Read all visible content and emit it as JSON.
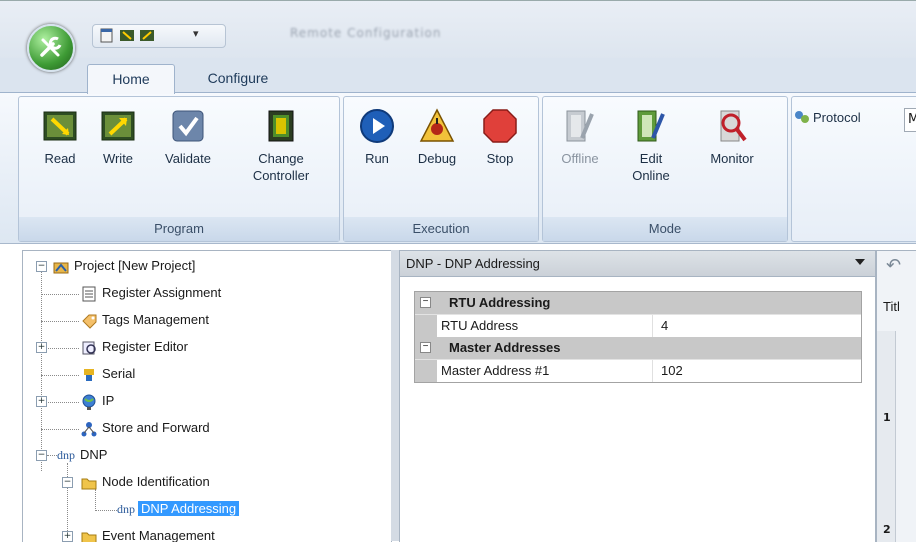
{
  "window": {
    "title_blurred": "Remote Configuration"
  },
  "tabs": [
    {
      "label": "Home",
      "active": true
    },
    {
      "label": "Configure",
      "active": false
    }
  ],
  "ribbon": {
    "groups": [
      {
        "title": "Program",
        "buttons": [
          {
            "label": "Read"
          },
          {
            "label": "Write"
          },
          {
            "label": "Validate"
          },
          {
            "label_line1": "Change",
            "label_line2": "Controller"
          }
        ]
      },
      {
        "title": "Execution",
        "buttons": [
          {
            "label": "Run"
          },
          {
            "label": "Debug"
          },
          {
            "label": "Stop"
          }
        ]
      },
      {
        "title": "Mode",
        "buttons": [
          {
            "label": "Offline",
            "enabled": false
          },
          {
            "label_line1": "Edit",
            "label_line2": "Online"
          },
          {
            "label": "Monitor"
          }
        ]
      }
    ],
    "protocol_label": "Protocol",
    "protocol_value": "M"
  },
  "tree": {
    "items": [
      {
        "label": "Project [New Project]"
      },
      {
        "label": "Register Assignment"
      },
      {
        "label": "Tags Management"
      },
      {
        "label": "Register Editor"
      },
      {
        "label": "Serial"
      },
      {
        "label": "IP"
      },
      {
        "label": "Store and Forward"
      },
      {
        "label": "DNP"
      },
      {
        "label": "Node Identification"
      },
      {
        "label": "DNP Addressing",
        "selected": true
      },
      {
        "label": "Event Management"
      }
    ]
  },
  "properties": {
    "header": "DNP - DNP Addressing",
    "categories": [
      {
        "name": "RTU Addressing",
        "rows": [
          {
            "name": "RTU Address",
            "value": "4"
          }
        ]
      },
      {
        "name": "Master Addresses",
        "rows": [
          {
            "name": "Master Address #1",
            "value": "102"
          }
        ]
      }
    ]
  },
  "right_panel": {
    "title_partial": "Titl",
    "row_numbers": [
      "1",
      "2"
    ]
  },
  "colors": {
    "selection": "#3399ff",
    "ribbon_bg": "#dde7f2",
    "category_bg": "#c8c8c8"
  }
}
